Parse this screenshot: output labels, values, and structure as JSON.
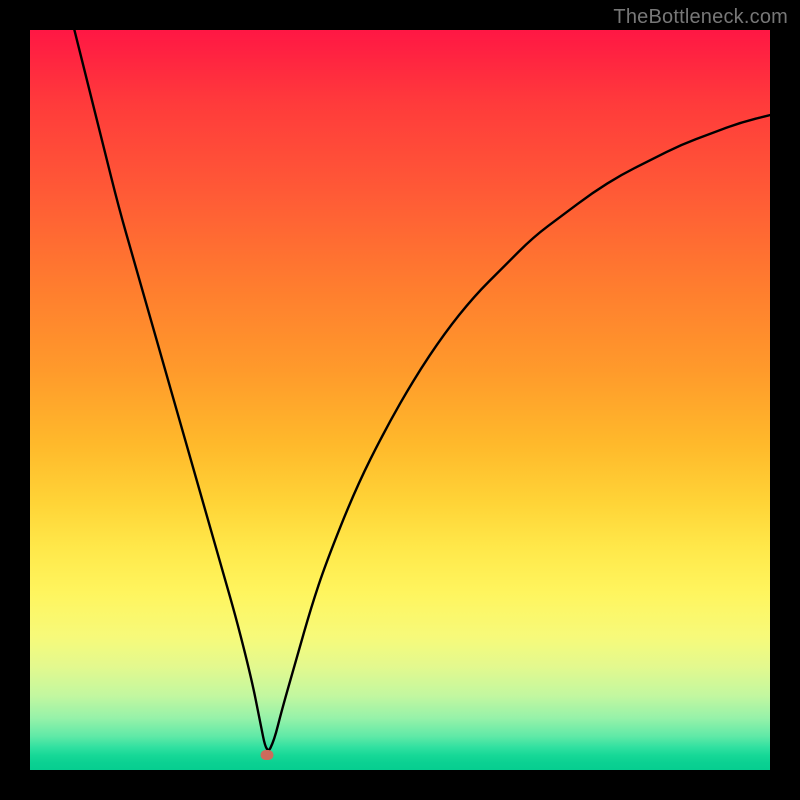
{
  "watermark": "TheBottleneck.com",
  "chart_data": {
    "type": "line",
    "title": "",
    "xlabel": "",
    "ylabel": "",
    "xlim": [
      0,
      100
    ],
    "ylim": [
      0,
      100
    ],
    "grid": false,
    "annotations": [
      {
        "name": "optimal-point",
        "x": 32,
        "y": 2
      }
    ],
    "series": [
      {
        "name": "bottleneck-curve",
        "x": [
          6,
          8,
          10,
          12,
          14,
          16,
          18,
          20,
          22,
          24,
          26,
          28,
          30,
          31,
          32,
          33,
          34,
          36,
          38,
          40,
          44,
          48,
          52,
          56,
          60,
          64,
          68,
          72,
          76,
          80,
          84,
          88,
          92,
          96,
          100
        ],
        "y": [
          100,
          92,
          84,
          76,
          69,
          62,
          55,
          48,
          41,
          34,
          27,
          20,
          12,
          7,
          2,
          4,
          8,
          15,
          22,
          28,
          38,
          46,
          53,
          59,
          64,
          68,
          72,
          75,
          78,
          80.5,
          82.5,
          84.5,
          86,
          87.5,
          88.5
        ]
      }
    ]
  }
}
